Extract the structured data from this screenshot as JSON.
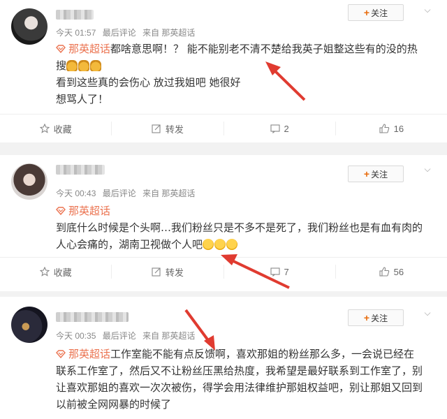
{
  "comments": [
    {
      "meta": {
        "time": "今天 01:57",
        "tag": "最后评论",
        "source": "来自 那英超话"
      },
      "follow_label": "关注",
      "topic": "那英超话",
      "lines": [
        "都啥意思啊！？ 能不能别老不清不楚给我英子姐整这些有的没的热",
        "搜",
        "看到这些真的会伤心 放过我姐吧 她很好",
        "想骂人了！"
      ],
      "actions": {
        "favorite": "收藏",
        "repost": "转发",
        "comment_count": "2",
        "like_count": "16"
      }
    },
    {
      "meta": {
        "time": "今天 00:43",
        "tag": "最后评论",
        "source": "来自 那英超话"
      },
      "follow_label": "关注",
      "topic": "那英超话",
      "lines": [
        "到底什么时候是个头啊…我们粉丝只是不多不是死了，我们粉丝也是有血有肉的",
        "人心会痛的，湖南卫视做个人吧"
      ],
      "actions": {
        "favorite": "收藏",
        "repost": "转发",
        "comment_count": "7",
        "like_count": "56"
      }
    },
    {
      "meta": {
        "time": "今天 00:35",
        "tag": "最后评论",
        "source": "来自 那英超话"
      },
      "follow_label": "关注",
      "topic": "那英超话",
      "lines": [
        "工作室能不能有点反馈啊，喜欢那姐的粉丝那么多，一会说已经在",
        "联系工作室了，然后又不让粉丝压黑给热度，我希望是最好联系到工作室了，别",
        "让喜欢那姐的喜欢一次次被伤，得学会用法律维护那姐权益吧，别让那姐又回到",
        "以前被全网网暴的时候了"
      ]
    }
  ],
  "colors": {
    "accent": "#e86b0c",
    "topic": "#eb7350",
    "arrow": "#e03b30"
  }
}
